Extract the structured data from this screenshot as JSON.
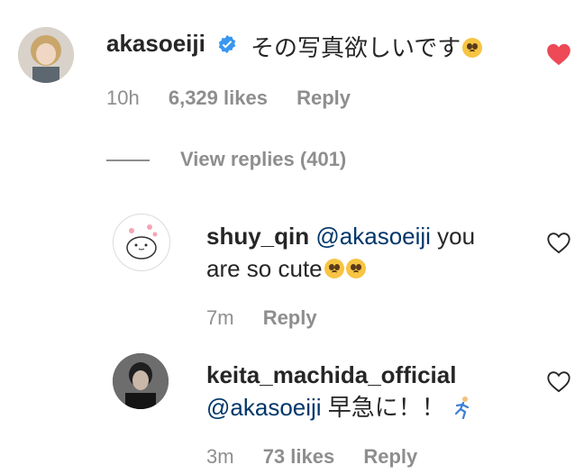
{
  "comments": [
    {
      "username": "akasoeiji",
      "verified": true,
      "text": "その写真欲しいです",
      "emoji": "pleading-face",
      "time": "10h",
      "likes": "6,329 likes",
      "reply": "Reply",
      "liked": true,
      "heart_color": "#ed4956"
    },
    {
      "username": "shuy_qin",
      "mention": "@akasoeiji",
      "text_line1": "you",
      "text_line2": "are so cute",
      "emoji": "pleading-face x2",
      "time": "7m",
      "reply": "Reply",
      "liked": false
    },
    {
      "username": "keita_machida_official",
      "mention": "@akasoeiji",
      "text": "早急に！！",
      "emoji": "running-man",
      "time": "3m",
      "likes": "73 likes",
      "reply": "Reply",
      "liked": false
    }
  ],
  "view_replies": "View replies (401)"
}
